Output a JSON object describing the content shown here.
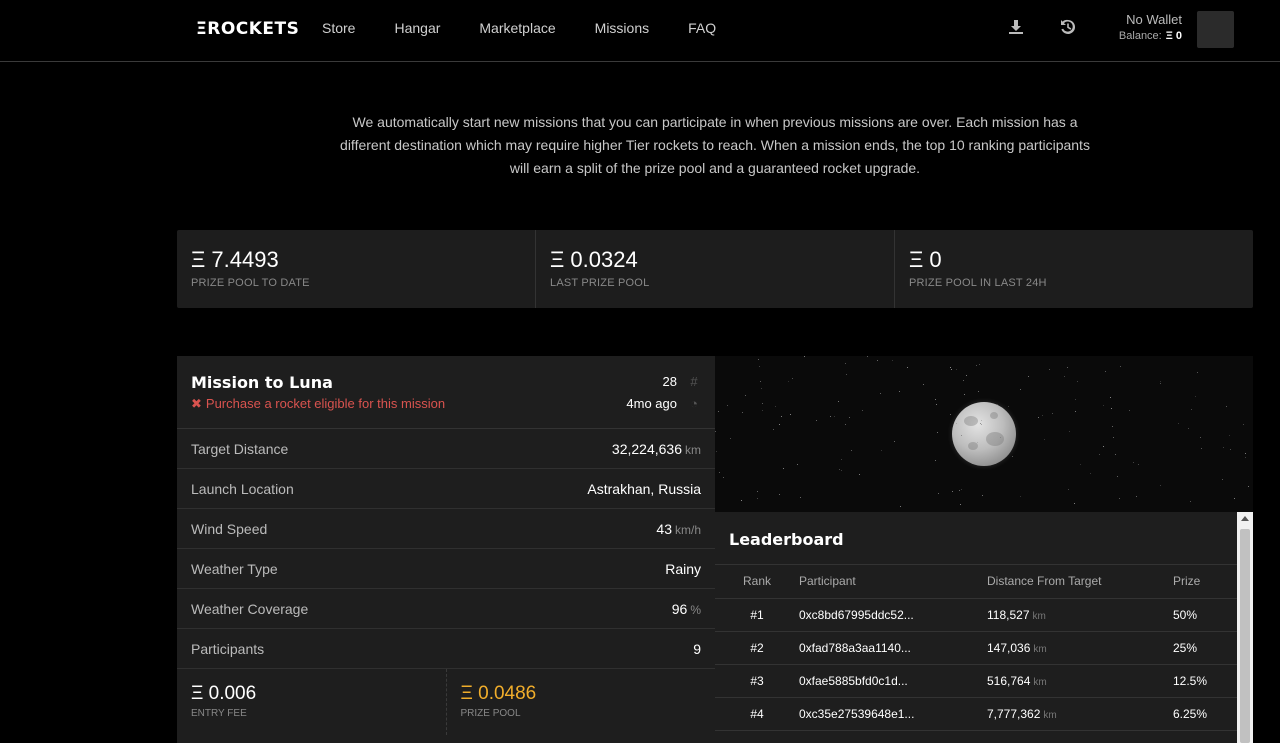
{
  "header": {
    "logo": "ΞROCKETS",
    "nav": [
      "Store",
      "Hangar",
      "Marketplace",
      "Missions",
      "FAQ"
    ],
    "wallet_name": "No Wallet",
    "balance_label": "Balance:",
    "balance_value": "Ξ 0"
  },
  "intro": "We automatically start new missions that you can participate in when previous missions are over. Each mission has a different destination which may require higher Tier rockets to reach. When a mission ends, the top 10 ranking participants will earn a split of the prize pool and a guaranteed rocket upgrade.",
  "stats": [
    {
      "value": "Ξ 7.4493",
      "label": "PRIZE POOL TO DATE"
    },
    {
      "value": "Ξ 0.0324",
      "label": "LAST PRIZE POOL"
    },
    {
      "value": "Ξ 0",
      "label": "PRIZE POOL IN LAST 24H"
    }
  ],
  "mission": {
    "title": "Mission to Luna",
    "warning": "Purchase a rocket eligible for this mission",
    "number": "28",
    "age": "4mo ago",
    "rows": [
      {
        "key": "Target Distance",
        "value": "32,224,636",
        "unit": "km"
      },
      {
        "key": "Launch Location",
        "value": "Astrakhan, Russia",
        "unit": ""
      },
      {
        "key": "Wind Speed",
        "value": "43",
        "unit": "km/h"
      },
      {
        "key": "Weather Type",
        "value": "Rainy",
        "unit": ""
      },
      {
        "key": "Weather Coverage",
        "value": "96",
        "unit": "%"
      },
      {
        "key": "Participants",
        "value": "9",
        "unit": ""
      }
    ],
    "entry_fee": "Ξ 0.006",
    "entry_fee_label": "ENTRY FEE",
    "prize_pool": "Ξ 0.0486",
    "prize_pool_label": "PRIZE POOL"
  },
  "leaderboard": {
    "title": "Leaderboard",
    "headers": [
      "Rank",
      "Participant",
      "Distance From Target",
      "Prize"
    ],
    "rows": [
      {
        "rank": "#1",
        "participant": "0xc8bd67995ddc52...",
        "distance": "118,527",
        "unit": "km",
        "prize": "50%"
      },
      {
        "rank": "#2",
        "participant": "0xfad788a3aa1140...",
        "distance": "147,036",
        "unit": "km",
        "prize": "25%"
      },
      {
        "rank": "#3",
        "participant": "0xfae5885bfd0c1d...",
        "distance": "516,764",
        "unit": "km",
        "prize": "12.5%"
      },
      {
        "rank": "#4",
        "participant": "0xc35e27539648e1...",
        "distance": "7,777,362",
        "unit": "km",
        "prize": "6.25%"
      }
    ]
  },
  "colors": {
    "accent_gold": "#f0ad2b",
    "warning_red": "#d9534f",
    "panel": "#1e1e1e"
  }
}
